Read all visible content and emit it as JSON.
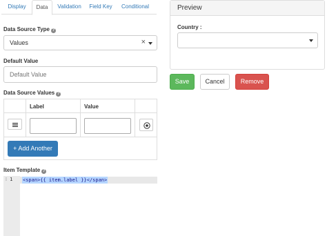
{
  "tabs": [
    {
      "label": "Display",
      "active": false
    },
    {
      "label": "Data",
      "active": true
    },
    {
      "label": "Validation",
      "active": false
    },
    {
      "label": "Field Key",
      "active": false
    },
    {
      "label": "Conditional",
      "active": false
    }
  ],
  "form": {
    "data_source_type_label": "Data Source Type",
    "data_source_type_value": "Values",
    "clear_symbol": "×",
    "default_value_label": "Default Value",
    "default_value_placeholder": "Default Value",
    "data_source_values_label": "Data Source Values",
    "table_headers": {
      "label": "Label",
      "value": "Value"
    },
    "table_rows": [
      {
        "label": "",
        "value": ""
      }
    ],
    "add_another_label": "+ Add Another",
    "item_template_label": "Item Template",
    "help_symbol": "?"
  },
  "editor": {
    "line_numbers": [
      "1"
    ],
    "code_lines": [
      "<span>{{ item.label }}</span>"
    ]
  },
  "preview": {
    "title": "Preview",
    "country_label": "Country :",
    "country_value": ""
  },
  "actions": {
    "save_label": "Save",
    "cancel_label": "Cancel",
    "remove_label": "Remove"
  },
  "colors": {
    "primary": "#337ab7",
    "success": "#5cb85c",
    "danger": "#d9534f",
    "code_selection": "#b5d5ff"
  },
  "icons": {
    "drag": "drag-handle-icon",
    "remove": "remove-circle-icon",
    "caret": "caret-down-icon",
    "help": "question-circle-icon"
  }
}
